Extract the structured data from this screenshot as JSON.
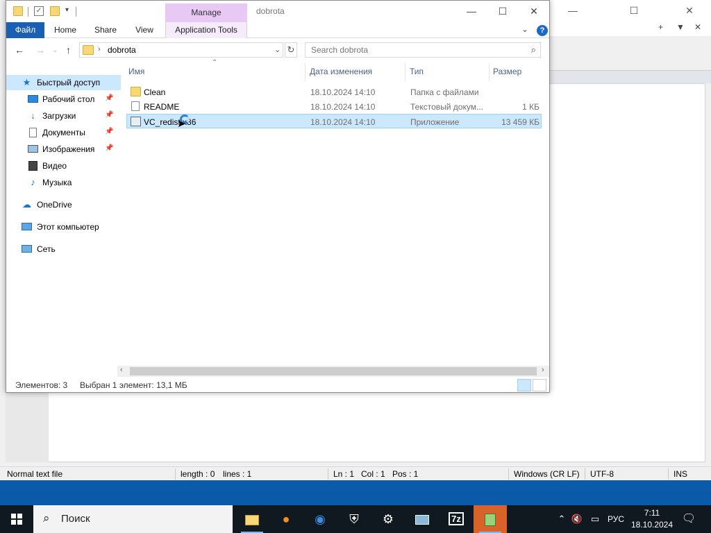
{
  "notepad": {
    "status": {
      "filetype": "Normal text file",
      "length": "length : 0",
      "lines": "lines : 1",
      "ln": "Ln : 1",
      "col": "Col : 1",
      "pos": "Pos : 1",
      "eol": "Windows (CR LF)",
      "encoding": "UTF-8",
      "mode": "INS"
    }
  },
  "explorer": {
    "window_title": "dobrota",
    "manage_tab": "Manage",
    "ribbon": {
      "file": "Файл",
      "home": "Home",
      "share": "Share",
      "view": "View",
      "app_tools": "Application Tools"
    },
    "address": {
      "path": "dobrota"
    },
    "search": {
      "placeholder": "Search dobrota"
    },
    "nav": [
      {
        "label": "Быстрый доступ",
        "icon": "star-icon"
      },
      {
        "label": "Рабочий стол",
        "icon": "desktop-icon"
      },
      {
        "label": "Загрузки",
        "icon": "download-icon"
      },
      {
        "label": "Документы",
        "icon": "documents-icon"
      },
      {
        "label": "Изображения",
        "icon": "pictures-icon"
      },
      {
        "label": "Видео",
        "icon": "video-icon"
      },
      {
        "label": "Музыка",
        "icon": "music-icon"
      },
      {
        "label": "OneDrive",
        "icon": "cloud-icon"
      },
      {
        "label": "Этот компьютер",
        "icon": "computer-icon"
      },
      {
        "label": "Сеть",
        "icon": "network-icon"
      }
    ],
    "columns": {
      "name": "Имя",
      "date": "Дата изменения",
      "type": "Тип",
      "size": "Размер"
    },
    "files": [
      {
        "name": "Clean",
        "date": "18.10.2024 14:10",
        "type": "Папка с файлами",
        "size": "",
        "icon": "folder-icon"
      },
      {
        "name": "README",
        "date": "18.10.2024 14:10",
        "type": "Текстовый докум...",
        "size": "1 КБ",
        "icon": "text-file-icon"
      },
      {
        "name": "VC_redist.x86",
        "date": "18.10.2024 14:10",
        "type": "Приложение",
        "size": "13 459 КБ",
        "icon": "application-icon",
        "selected": true
      }
    ],
    "status": {
      "count": "Элементов: 3",
      "selection": "Выбран 1 элемент: 13,1 МБ"
    }
  },
  "taskbar": {
    "search_placeholder": "Поиск",
    "apps": [
      "file-explorer-icon",
      "firefox-icon",
      "chromium-icon",
      "security-icon",
      "settings-icon",
      "network-manager-icon",
      "7zip-icon",
      "notepad-plus-icon"
    ],
    "tray": {
      "language": "РУС",
      "time": "7:11",
      "date": "18.10.2024"
    }
  },
  "colors": {
    "accent": "#1a5fb4",
    "selection": "#cce8ff",
    "manage_tab": "#e8c9f5",
    "taskbar": "#101820",
    "desktop": "#0a63b8"
  }
}
